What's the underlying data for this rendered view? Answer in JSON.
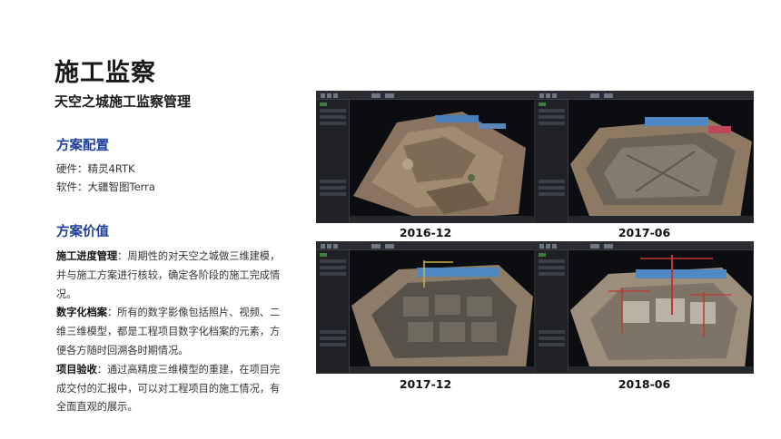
{
  "page": {
    "title": "施工监察",
    "subtitle": "天空之城施工监察管理"
  },
  "config": {
    "heading": "方案配置",
    "hardware": "硬件：精灵4RTK",
    "software": "软件：大疆智图Terra"
  },
  "value": {
    "heading": "方案价值",
    "items": [
      {
        "term": "施工进度管理",
        "text": "：周期性的对天空之城做三维建模，并与施工方案进行核较，确定各阶段的施工完成情况。"
      },
      {
        "term": "数字化档案",
        "text": "：所有的数字影像包括照片、视频、二维三维模型，都是工程项目数字化档案的元素，方便各方随时回溯各时期情况。"
      },
      {
        "term": "项目验收",
        "text": "：通过高精度三维模型的重建，在项目完成交付的汇报中，可以对工程项目的施工情况，有全面直观的展示。"
      }
    ]
  },
  "snapshots": [
    {
      "date": "2016-12"
    },
    {
      "date": "2017-06"
    },
    {
      "date": "2017-12"
    },
    {
      "date": "2018-06"
    }
  ]
}
